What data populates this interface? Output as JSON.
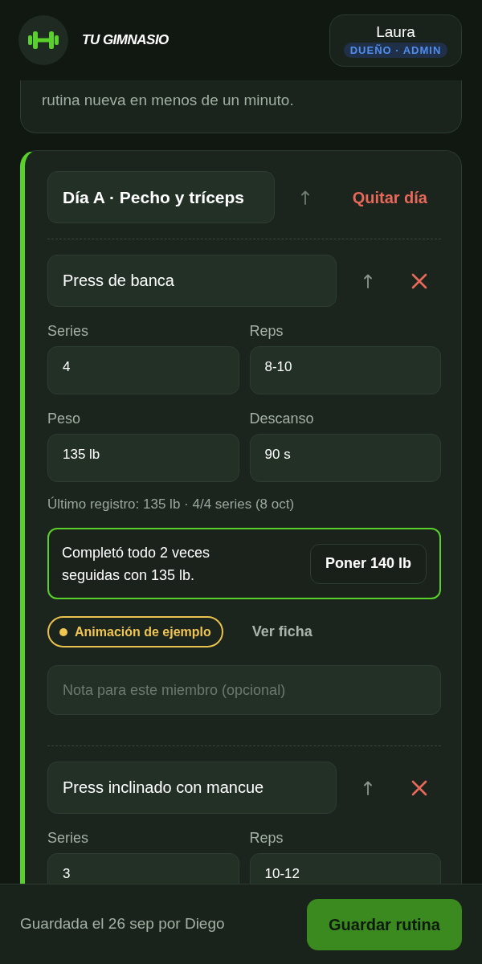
{
  "header": {
    "brand": "TU GIMNASIO",
    "user": {
      "name": "Laura",
      "role": "DUEÑO · ADMIN"
    }
  },
  "intro_card": {
    "text": "rutina nueva en menos de un minuto."
  },
  "day": {
    "name": "Día A · Pecho y tríceps",
    "remove_label": "Quitar día",
    "exercises": [
      {
        "name": "Press de banca",
        "fields": [
          {
            "label": "Series",
            "value": "4"
          },
          {
            "label": "Reps",
            "value": "8-10"
          },
          {
            "label": "Peso",
            "value": "135 lb"
          },
          {
            "label": "Descanso",
            "value": "90 s"
          }
        ],
        "last_log": "Último registro: 135 lb · 4/4 series (8 oct)",
        "suggestion": {
          "text": "Completó todo 2 veces seguidas con 135 lb.",
          "button": "Poner 140 lb"
        },
        "demo_badge": "Animación de ejemplo",
        "details_link": "Ver ficha",
        "note": {
          "placeholder": "Nota para este miembro (opcional)"
        }
      },
      {
        "name": "Press inclinado con mancue",
        "fields": [
          {
            "label": "Series",
            "value": "3"
          },
          {
            "label": "Reps",
            "value": "10-12"
          }
        ]
      }
    ]
  },
  "footer": {
    "saved_text": "Guardada el 26 sep por Diego",
    "save_button": "Guardar rutina"
  }
}
